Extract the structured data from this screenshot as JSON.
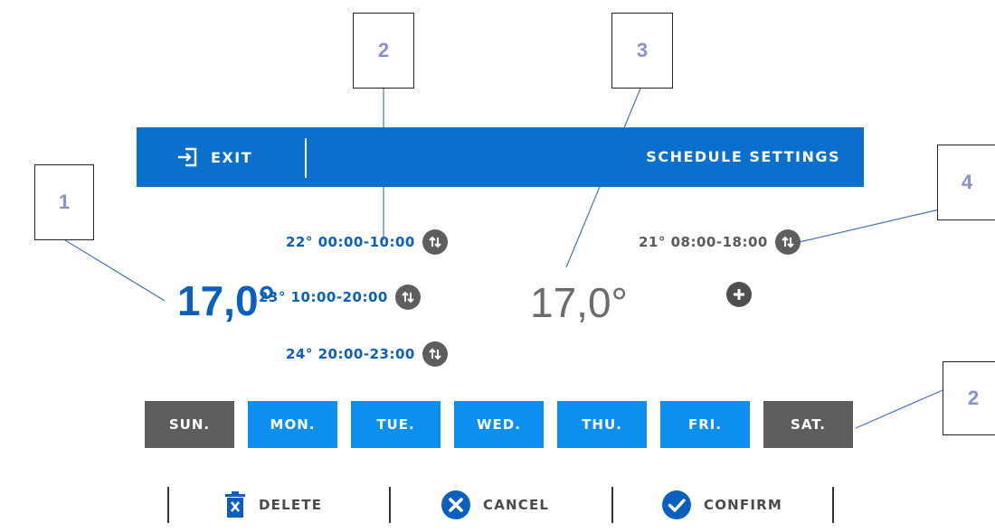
{
  "callouts": [
    "1",
    "2",
    "3",
    "2",
    "4"
  ],
  "header": {
    "exit_label": "EXIT",
    "title": "SCHEDULE SETTINGS",
    "color": "#0a6fcd"
  },
  "current_temp": "17,0°",
  "intervals_left": [
    {
      "temp": "22°",
      "time": "00:00-10:00"
    },
    {
      "temp": "23°",
      "time": "10:00-20:00"
    },
    {
      "temp": "24°",
      "time": "20:00-23:00"
    }
  ],
  "default_temp": "17,0°",
  "intervals_right": [
    {
      "temp": "21°",
      "time": "08:00-18:00"
    }
  ],
  "days": [
    {
      "label": "SUN.",
      "selected": false
    },
    {
      "label": "MON.",
      "selected": true
    },
    {
      "label": "TUE.",
      "selected": true
    },
    {
      "label": "WED.",
      "selected": true
    },
    {
      "label": "THU.",
      "selected": true
    },
    {
      "label": "FRI.",
      "selected": true
    },
    {
      "label": "SAT.",
      "selected": false
    }
  ],
  "actions": {
    "delete_label": "DELETE",
    "cancel_label": "CANCEL",
    "confirm_label": "CONFIRM"
  },
  "icons": [
    "exit-icon",
    "swap-icon",
    "add-icon",
    "trash-icon",
    "cancel-icon",
    "confirm-icon"
  ],
  "colors": {
    "accent_blue": "#0b5fbf",
    "day_selected": "#0d8ff0",
    "day_unselected": "#5e5d5b"
  }
}
